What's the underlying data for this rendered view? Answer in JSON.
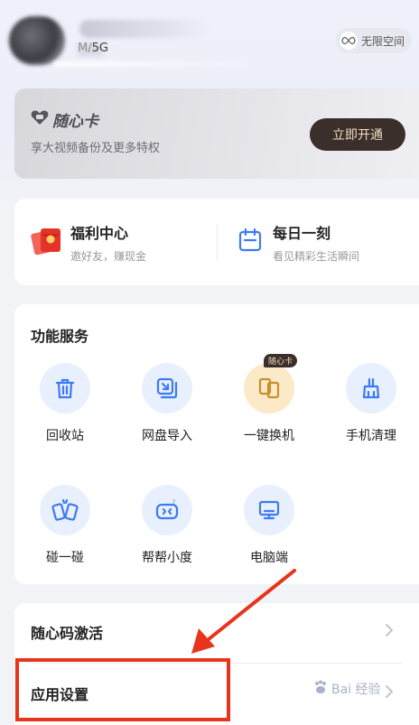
{
  "header": {
    "storage_text": "5G",
    "unlimited_space_label": "无限空间"
  },
  "vip_card": {
    "title": "随心卡",
    "subtitle": "享大视频备份及更多特权",
    "button_label": "立即开通"
  },
  "welfare": {
    "left": {
      "title": "福利中心",
      "subtitle": "邀好友，赚现金"
    },
    "right": {
      "title": "每日一刻",
      "subtitle": "看见精彩生活瞬间"
    }
  },
  "services": {
    "title": "功能服务",
    "items": [
      {
        "label": "回收站",
        "icon": "trash-icon"
      },
      {
        "label": "网盘导入",
        "icon": "import-icon"
      },
      {
        "label": "一键换机",
        "icon": "phone-swap-icon",
        "badge": "随心卡"
      },
      {
        "label": "手机清理",
        "icon": "broom-icon"
      },
      {
        "label": "碰一碰",
        "icon": "tap-phones-icon"
      },
      {
        "label": "帮帮小度",
        "icon": "robot-icon"
      },
      {
        "label": "电脑端",
        "icon": "monitor-icon"
      }
    ]
  },
  "settings_list": [
    {
      "label": "随心码激活"
    },
    {
      "label": "应用设置"
    }
  ],
  "watermark": {
    "text": "Bai 经验"
  },
  "colors": {
    "accent_red": "#e8341c",
    "icon_blue": "#3d7af5",
    "vip_dark": "#3a2f2a",
    "vip_gold_text": "#f3dcc0"
  }
}
